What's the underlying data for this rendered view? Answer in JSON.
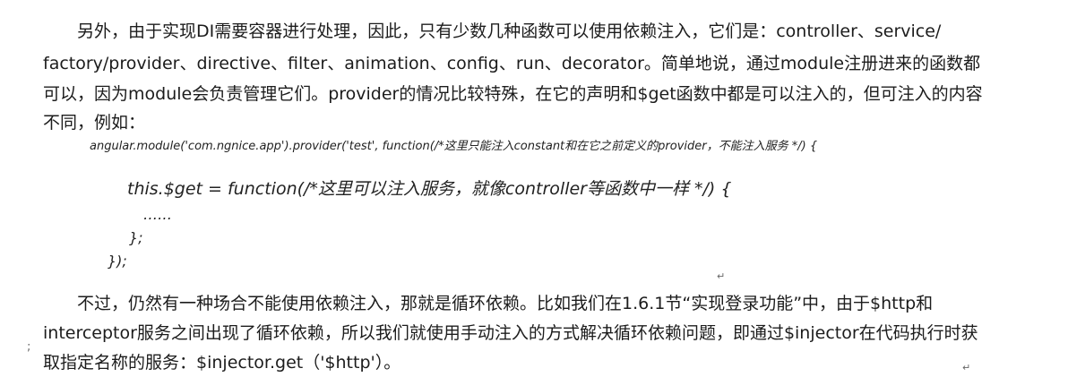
{
  "paragraph1": {
    "line1": "另外，由于实现DI需要容器进行处理，因此，只有少数几种函数可以使用依赖注入，它们是：controller、service/",
    "line2": "factory/provider、directive、filter、animation、config、run、decorator。简单地说，通过module注册进来的函数都",
    "line3": "可以，因为module会负责管理它们。provider的情况比较特殊，在它的声明和$get函数中都是可以注入的，但可注入的内容",
    "line4": "不同，例如："
  },
  "code": {
    "line1": "angular.module('com.ngnice.app').provider('test', function(/*这里只能注入constant和在它之前定义的provider，不能注入服务 */) {",
    "line2": "this.$get = function(/*这里可以注入服务，就像controller等函数中一样 */) {",
    "line3": "……",
    "line4": "};",
    "line5": "});"
  },
  "paragraph2": {
    "line1": "不过，仍然有一种场合不能使用依赖注入，那就是循环依赖。比如我们在1.6.1节“实现登录功能”中，由于$http和",
    "line2": "interceptor服务之间出现了循环依赖，所以我们就使用手动注入的方式解决循环依赖问题，即通过$injector在代码执行时获",
    "line3": "取指定名称的服务：$injector.get（'$http'）。"
  },
  "marks": {
    "return_mark": "↵",
    "side_mark": ";"
  }
}
